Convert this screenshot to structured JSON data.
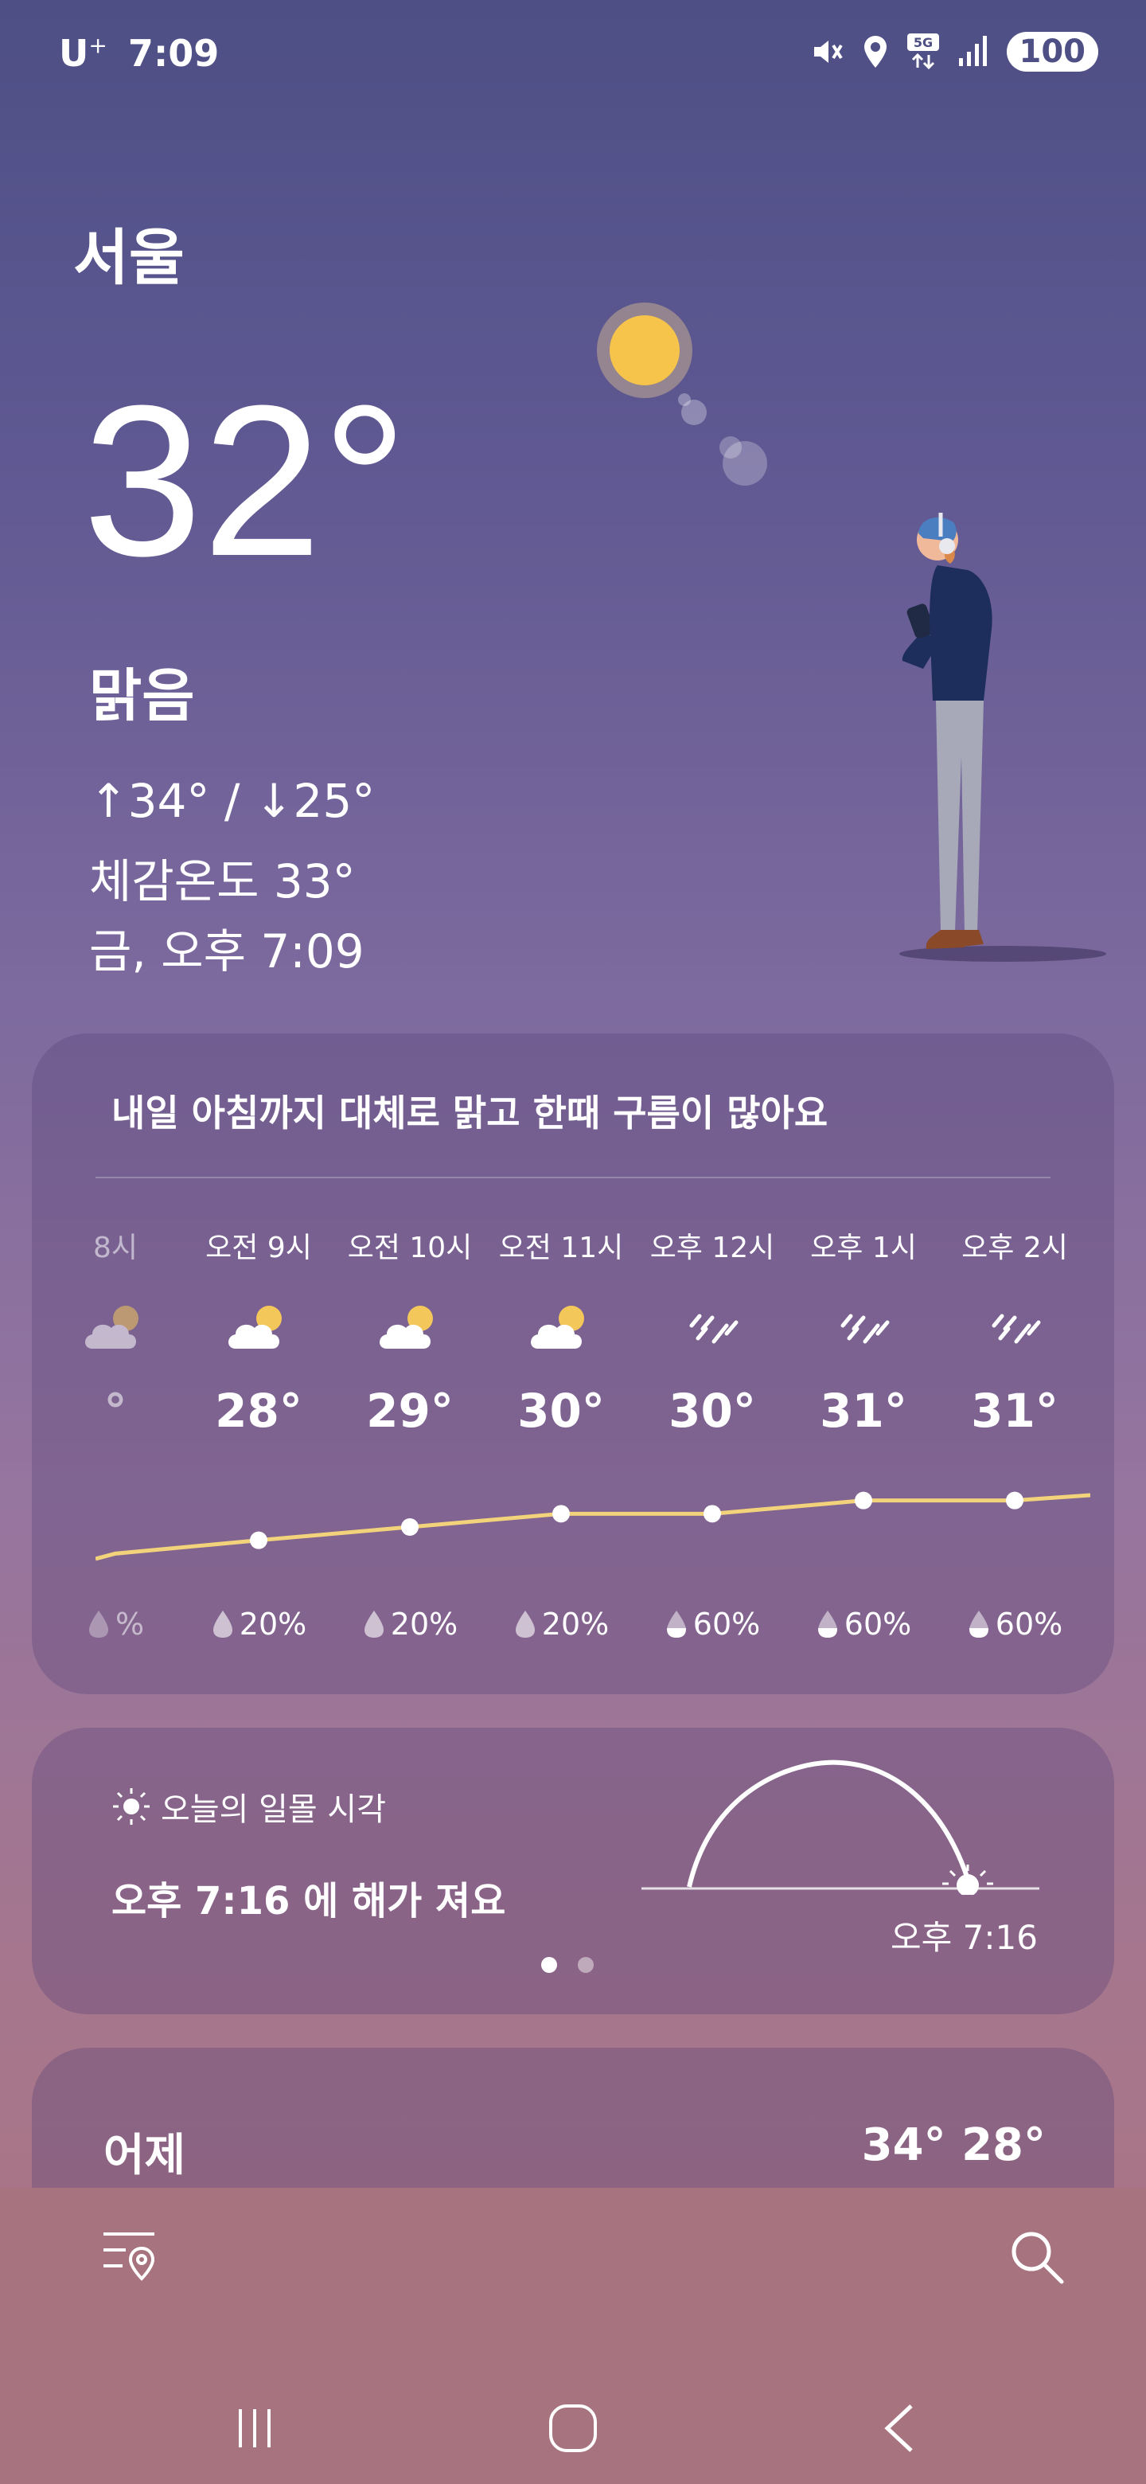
{
  "status": {
    "carrier": "U",
    "carrier_sup": "+",
    "time": "7:09",
    "battery": "100"
  },
  "location": {
    "city": "서울"
  },
  "current": {
    "temperature": "32°",
    "condition": "맑음",
    "high_low": "↑34° / ↓25°",
    "feels_like": "체감온도 33°",
    "datetime": "금, 오후 7:09"
  },
  "hourly": {
    "summary": "내일 아침까지 대체로 맑고 한때 구름이 많아요",
    "items": [
      {
        "time": "8시",
        "icon": "partly-cloudy-icon",
        "temp": "°",
        "precip": "%",
        "temp_value": 27
      },
      {
        "time": "오전 9시",
        "icon": "partly-cloudy-icon",
        "temp": "28°",
        "precip": "20%",
        "temp_value": 28
      },
      {
        "time": "오전 10시",
        "icon": "partly-cloudy-icon",
        "temp": "29°",
        "precip": "20%",
        "temp_value": 29
      },
      {
        "time": "오전 11시",
        "icon": "partly-cloudy-icon",
        "temp": "30°",
        "precip": "20%",
        "temp_value": 30
      },
      {
        "time": "오후 12시",
        "icon": "rain-icon",
        "temp": "30°",
        "precip": "60%",
        "temp_value": 30
      },
      {
        "time": "오후 1시",
        "icon": "rain-icon",
        "temp": "31°",
        "precip": "60%",
        "temp_value": 31
      },
      {
        "time": "오후 2시",
        "icon": "rain-icon",
        "temp": "31°",
        "precip": "60%",
        "temp_value": 31
      }
    ]
  },
  "sunset": {
    "label": "오늘의 일몰 시각",
    "text": "오후 7:16 에 해가 져요",
    "time": "오후 7:16"
  },
  "yesterday": {
    "label": "어제",
    "temps": "34° 28°"
  },
  "colors": {
    "accent_line": "#f2d27a",
    "sun": "#f6c44a"
  }
}
